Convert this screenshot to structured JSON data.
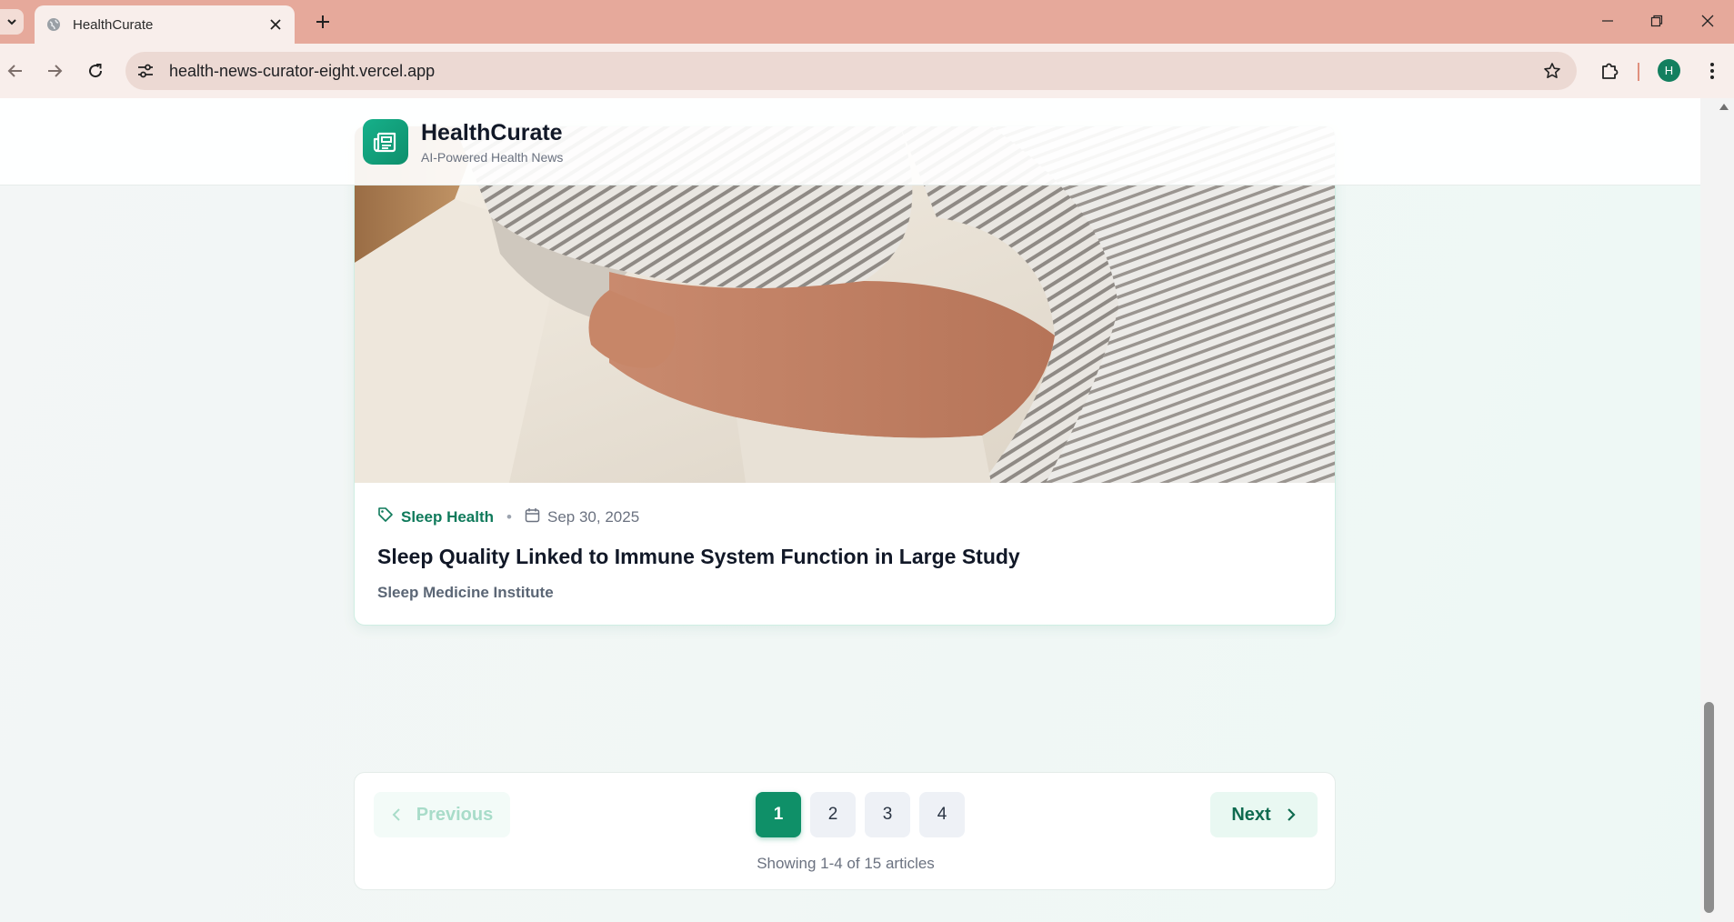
{
  "browser": {
    "tab_title": "HealthCurate",
    "url": "health-news-curator-eight.vercel.app",
    "profile_initial": "H"
  },
  "site": {
    "name": "HealthCurate",
    "tagline": "AI-Powered Health News"
  },
  "article": {
    "category": "Sleep Health",
    "date": "Sep 30, 2025",
    "title": "Sleep Quality Linked to Immune System Function in Large Study",
    "source": "Sleep Medicine Institute",
    "image_alt": "Person sleeping hugging a striped pillow"
  },
  "pagination": {
    "previous_label": "Previous",
    "next_label": "Next",
    "pages": [
      "1",
      "2",
      "3",
      "4"
    ],
    "current_page": "1",
    "summary": "Showing 1-4 of 15 articles"
  },
  "colors": {
    "brand": "#0f9068",
    "accent_text": "#0f7a5b",
    "tab_strip": "#e6a99b"
  }
}
